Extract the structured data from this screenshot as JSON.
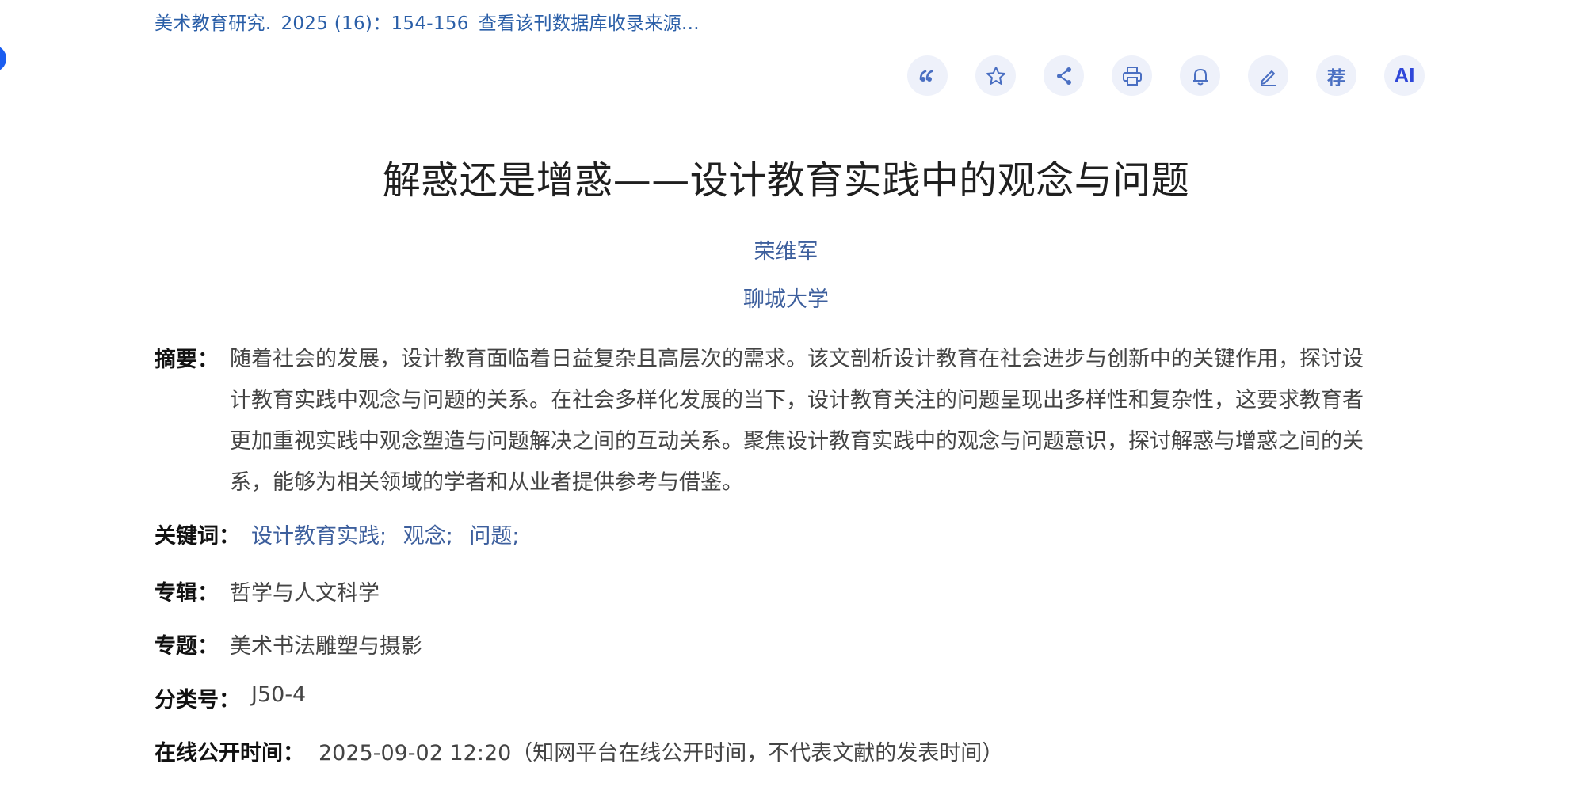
{
  "source": {
    "journal": "美术教育研究",
    "issue": "2025 (16)",
    "pages": "：154-156",
    "db_link": "查看该刊数据库收录来源..."
  },
  "toolbar": {
    "recommend_label": "荐",
    "ai_label": "AI"
  },
  "title": "解惑还是增惑——设计教育实践中的观念与问题",
  "author": "荣维军",
  "organization": "聊城大学",
  "abstract": {
    "label": "摘要：",
    "lines": [
      "随着社会的发展，设计教育面临着日益复杂且高层次的需求。该文剖析设计教育在社会进步与创新中的关键作用，探讨设",
      "计教育实践中观念与问题的关系。在社会多样化发展的当下，设计教育关注的问题呈现出多样性和复杂性，这要求教育者",
      "更加重视实践中观念塑造与问题解决之间的互动关系。聚焦设计教育实践中的观念与问题意识，探讨解惑与增惑之间的关",
      "系，能够为相关领域的学者和从业者提供参考与借鉴。"
    ]
  },
  "keywords": {
    "label": "关键词：",
    "items": [
      "设计教育实践;",
      "观念;",
      "问题;"
    ]
  },
  "album": {
    "label": "专辑：",
    "value": "哲学与人文科学"
  },
  "topic": {
    "label": "专题：",
    "value": "美术书法雕塑与摄影"
  },
  "classification": {
    "label": "分类号：",
    "value": "J50-4"
  },
  "online_time": {
    "label": "在线公开时间：",
    "value": "2025-09-02 12:20（知网平台在线公开时间，不代表文献的发表时间）"
  }
}
